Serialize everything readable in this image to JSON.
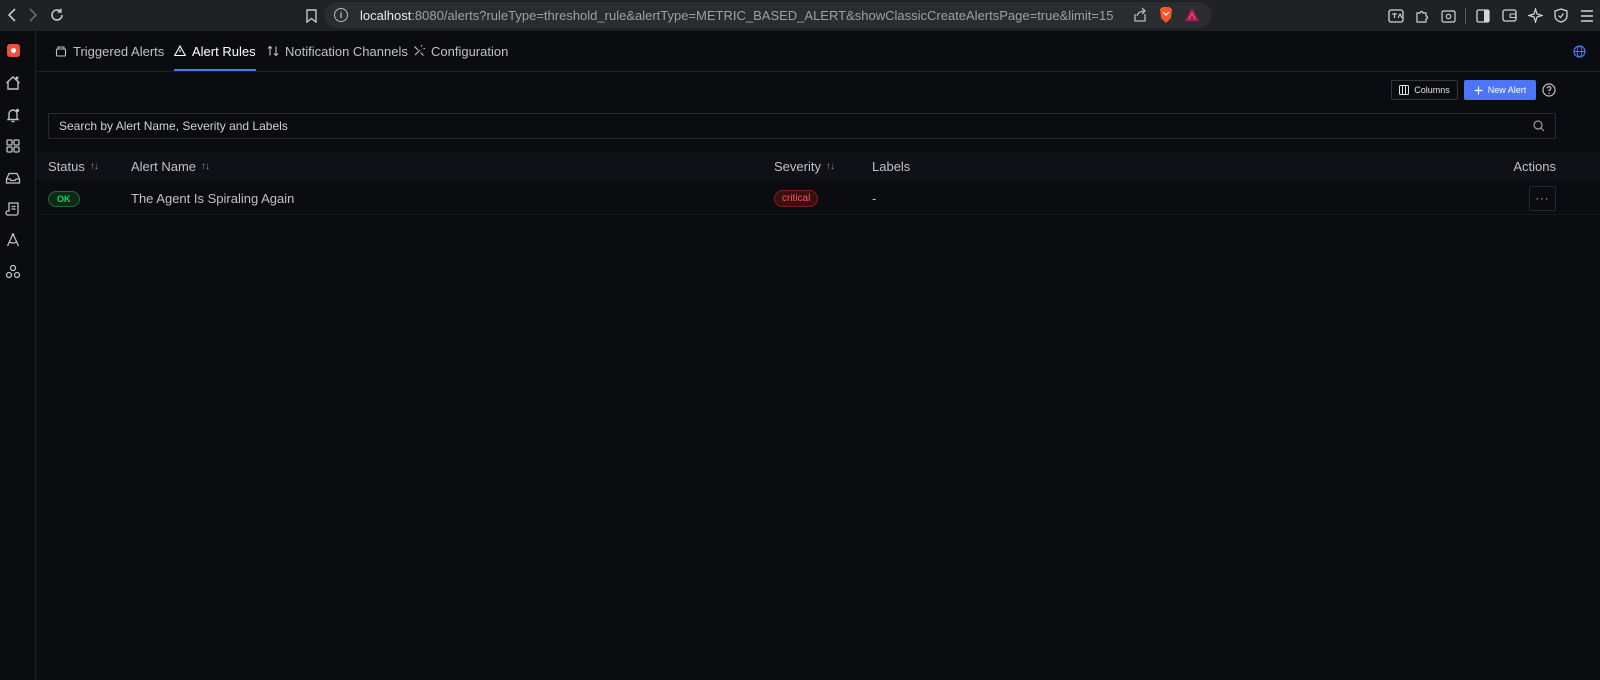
{
  "browser": {
    "url_host": "localhost",
    "url_rest": ":8080/alerts?ruleType=threshold_rule&alertType=METRIC_BASED_ALERT&showClassicCreateAlertsPage=true&limit=15"
  },
  "tabs": [
    {
      "label": "Triggered Alerts",
      "icon": "inbox-icon"
    },
    {
      "label": "Alert Rules",
      "icon": "warning-icon",
      "active": true
    },
    {
      "label": "Notification Channels",
      "icon": "switch-icon"
    },
    {
      "label": "Configuration",
      "icon": "tools-icon"
    }
  ],
  "toolbar": {
    "columns_label": "Columns",
    "new_alert_label": "New Alert"
  },
  "search": {
    "placeholder": "Search by Alert Name, Severity and Labels"
  },
  "table": {
    "headers": {
      "status": "Status",
      "alert_name": "Alert Name",
      "severity": "Severity",
      "labels": "Labels",
      "actions": "Actions"
    },
    "rows": [
      {
        "status": "OK",
        "alert_name": "The Agent Is Spiraling Again",
        "severity": "critical",
        "labels": "-",
        "actions": "···"
      }
    ]
  },
  "colors": {
    "accent": "#4e74f8",
    "ok": "#25d364",
    "critical": "#f0575a",
    "brand": "#e8513c"
  }
}
